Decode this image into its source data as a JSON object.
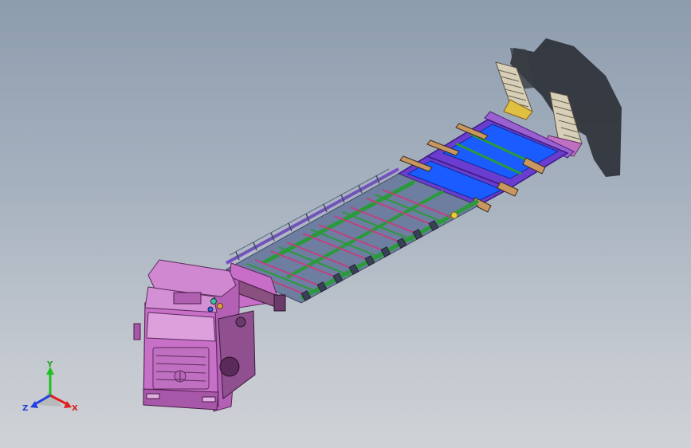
{
  "triad": {
    "x_label": "X",
    "y_label": "Y",
    "z_label": "Z",
    "x_color": "#e02020",
    "y_color": "#20c020",
    "z_color": "#2040e0"
  },
  "model": {
    "cab_color": "#c86ec8",
    "deck_blue": "#1a5cff",
    "rail_green": "#2a9a3a",
    "frame_purple": "#7a4ad0",
    "ramp_color": "#c8b898",
    "shadow_color": "#2b2f35"
  }
}
